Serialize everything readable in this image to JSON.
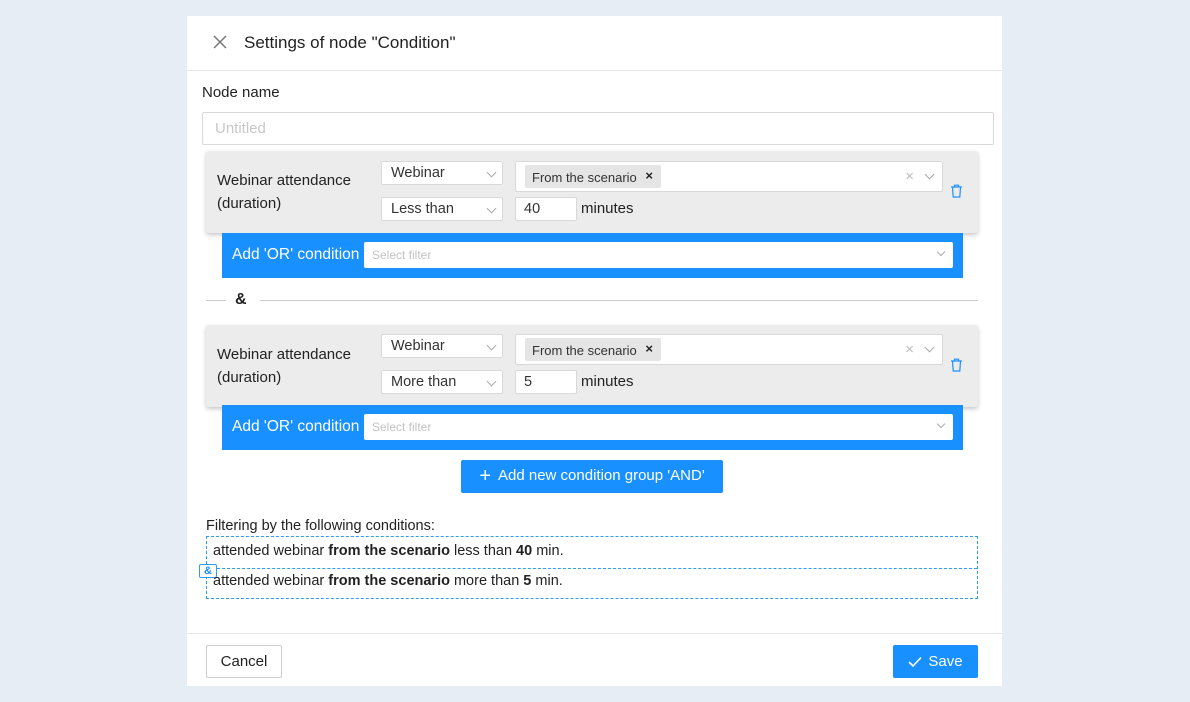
{
  "dialog": {
    "title": "Settings of node \"Condition\"",
    "node_name_label": "Node name",
    "node_name_placeholder": "Untitled",
    "node_name_value": ""
  },
  "groups": [
    {
      "condition_name": "Webinar attendance (duration)",
      "type_select": "Webinar",
      "tag": "From the scenario",
      "tag_remove": "×",
      "clear": "×",
      "operator_select": "Less than",
      "amount": "40",
      "unit": "minutes",
      "or_label": "Add 'OR' condition",
      "or_placeholder": "Select filter"
    },
    {
      "condition_name": "Webinar attendance (duration)",
      "type_select": "Webinar",
      "tag": "From the scenario",
      "tag_remove": "×",
      "clear": "×",
      "operator_select": "More than",
      "amount": "5",
      "unit": "minutes",
      "or_label": "Add 'OR' condition",
      "or_placeholder": "Select filter"
    }
  ],
  "and_symbol": "&",
  "add_group_label": "Add new condition group 'AND'",
  "summary": {
    "title": "Filtering by the following conditions:",
    "badge": "&",
    "lines": [
      {
        "p1": "attended webinar ",
        "b1": "from the scenario",
        "p2": " less than ",
        "b2": "40",
        "p3": " min."
      },
      {
        "p1": "attended webinar ",
        "b1": "from the scenario",
        "p2": " more than ",
        "b2": "5",
        "p3": " min."
      }
    ]
  },
  "footer": {
    "cancel_label": "Cancel",
    "save_label": "Save"
  },
  "colors": {
    "accent": "#1890ff",
    "background": "#e6edf4"
  }
}
